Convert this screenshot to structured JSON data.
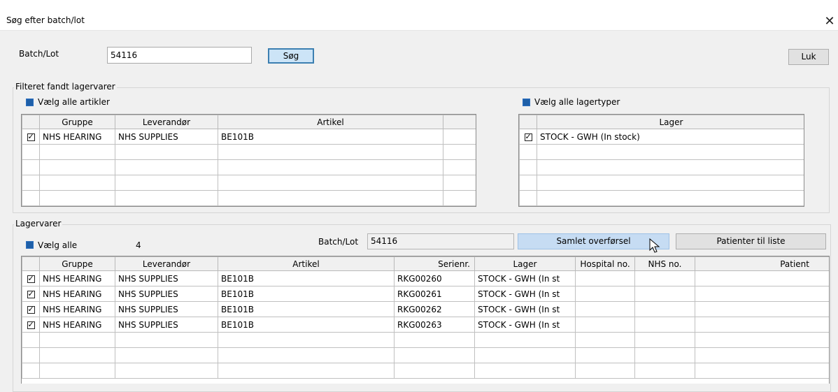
{
  "window": {
    "title": "Søg efter batch/lot",
    "close_glyph": "✕"
  },
  "search": {
    "label": "Batch/Lot",
    "value": "54116",
    "search_label": "Søg",
    "close_label": "Luk"
  },
  "filter": {
    "legend": "Filteret fandt lagervarer",
    "select_all_articles": "Vælg alle artikler",
    "select_all_types": "Vælg alle lagertyper",
    "articles_headers": [
      "Gruppe",
      "Leverandør",
      "Artikel"
    ],
    "articles_rows": [
      {
        "group": "NHS HEARING",
        "supplier": "NHS SUPPLIES",
        "article": "BE101B"
      }
    ],
    "stock_header": "Lager",
    "stock_rows": [
      {
        "lager": "STOCK - GWH (In stock)"
      }
    ]
  },
  "items": {
    "legend": "Lagervarer",
    "select_all": "Vælg alle",
    "count": "4",
    "batch_label": "Batch/Lot",
    "batch_value": "54116",
    "combined_transfer": "Samlet overførsel",
    "patients_to_list": "Patienter til liste",
    "headers": [
      "Gruppe",
      "Leverandør",
      "Artikel",
      "Serienr.",
      "Lager",
      "Hospital no.",
      "NHS no.",
      "Patient"
    ],
    "rows": [
      {
        "group": "NHS HEARING",
        "supplier": "NHS SUPPLIES",
        "article": "BE101B",
        "serial": "RKG00260",
        "lager": "STOCK - GWH (In st"
      },
      {
        "group": "NHS HEARING",
        "supplier": "NHS SUPPLIES",
        "article": "BE101B",
        "serial": "RKG00261",
        "lager": "STOCK - GWH (In st"
      },
      {
        "group": "NHS HEARING",
        "supplier": "NHS SUPPLIES",
        "article": "BE101B",
        "serial": "RKG00262",
        "lager": "STOCK - GWH (In st"
      },
      {
        "group": "NHS HEARING",
        "supplier": "NHS SUPPLIES",
        "article": "BE101B",
        "serial": "RKG00263",
        "lager": "STOCK - GWH (In st"
      }
    ]
  },
  "colors": {
    "accent": "#1e5fa8",
    "button_focus": "#cce4f7"
  }
}
